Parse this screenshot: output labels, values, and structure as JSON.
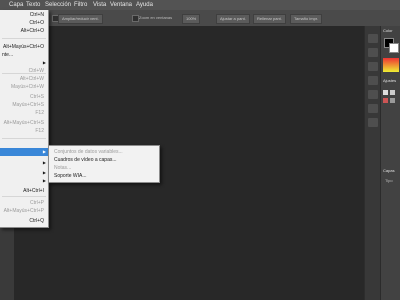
{
  "menubar": {
    "items": [
      "Capa",
      "Texto",
      "Selección",
      "Filtro",
      "Vista",
      "Ventana",
      "Ayuda"
    ]
  },
  "options_bar": {
    "btn1": "Ampliar/reducir vent.",
    "check1": "Zoom en ventanas",
    "btn2": "100%",
    "btn3": "Ajustar a pant.",
    "btn4": "Rellenar pant.",
    "btn5": "Tamaño impr."
  },
  "file_menu": {
    "items": [
      {
        "label": "",
        "shortcut": "Ctrl+N"
      },
      {
        "label": "",
        "shortcut": "Ctrl+O"
      },
      {
        "label": "",
        "shortcut": "Alt+Ctrl+O"
      },
      {
        "label": "",
        "shortcut": "Alt+Mayús+Ctrl+O"
      },
      {
        "label": "nte...",
        "shortcut": ""
      },
      {
        "label": "",
        "shortcut": "Ctrl+W"
      },
      {
        "label": "",
        "shortcut": "Alt+Ctrl+W"
      },
      {
        "label": "",
        "shortcut": "Mayús+Ctrl+W"
      },
      {
        "label": "",
        "shortcut": "Ctrl+S"
      },
      {
        "label": "",
        "shortcut": "Mayús+Ctrl+S"
      },
      {
        "label": "",
        "shortcut": "F12"
      },
      {
        "label": "",
        "shortcut": "Alt+Mayús+Ctrl+S"
      },
      {
        "label": "",
        "shortcut": "F12"
      },
      {
        "label": "",
        "shortcut": "Alt+Ctrl+I"
      },
      {
        "label": "",
        "shortcut": "Ctrl+P"
      },
      {
        "label": "",
        "shortcut": "Alt+Mayús+Ctrl+P"
      },
      {
        "label": "",
        "shortcut": "Ctrl+Q"
      }
    ]
  },
  "import_submenu": {
    "items": [
      {
        "label": "Conjuntos de datos variables..."
      },
      {
        "label": "Cuadros de vídeo a capas..."
      },
      {
        "label": "Notas..."
      },
      {
        "label": "Soporte WIA..."
      }
    ]
  },
  "panels": {
    "color_tab": "Color",
    "adjust_tab": "Ajustes",
    "layers_tab": "Capas",
    "type_label": "Tipo"
  },
  "colors": {
    "highlight": "#3a87d8",
    "workspace": "#272727",
    "menubar": "#535353"
  }
}
